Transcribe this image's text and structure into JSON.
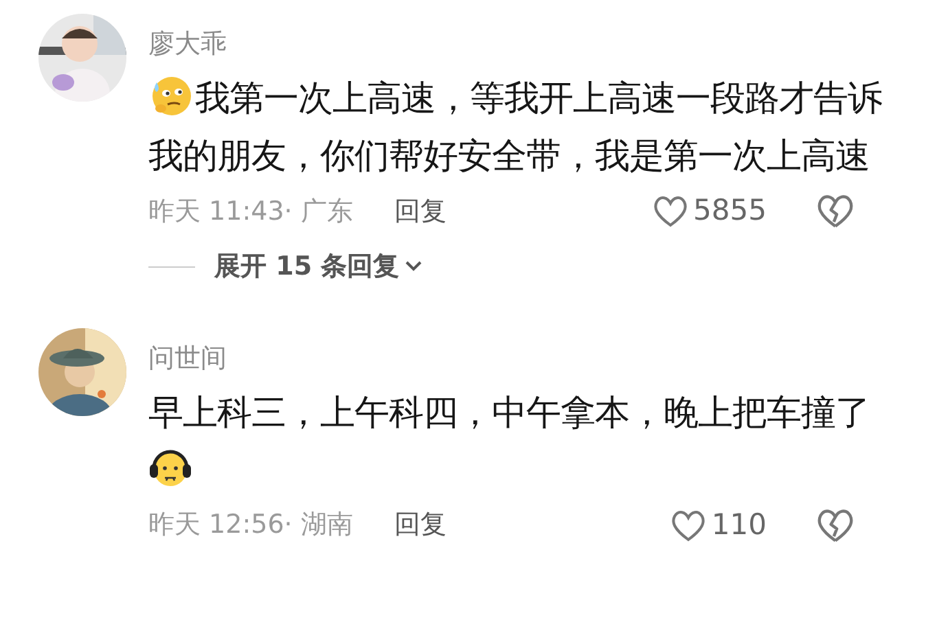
{
  "comments": [
    {
      "author": "廖大乖",
      "content": [
        {
          "kind": "thinking-emoji"
        },
        {
          "kind": "text",
          "text": "我第一次上高速，等我开上高速一段路才告诉我的朋友，你们帮好安全带，我是第一次上高速"
        }
      ],
      "meta": "昨天 11:43· 广东",
      "reply": "回复",
      "likes": "5855",
      "liked": false,
      "expand": "展开 15 条回复"
    },
    {
      "author": "问世间",
      "content": [
        {
          "kind": "text",
          "text": "早上科三，上午科四，中午拿本，晚上把车撞了"
        },
        {
          "kind": "headphones-emoji"
        }
      ],
      "meta": "昨天 12:56· 湖南",
      "reply": "回复",
      "likes": "110",
      "liked": false
    }
  ]
}
